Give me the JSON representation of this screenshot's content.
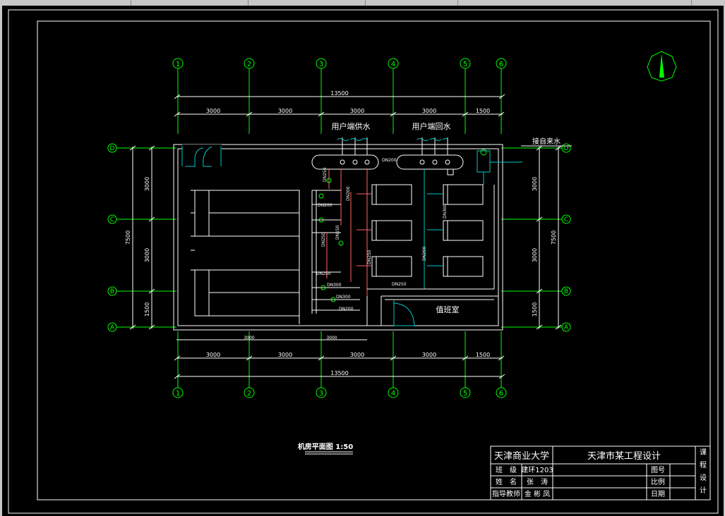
{
  "drawing": {
    "axes_top": [
      "1",
      "2",
      "3",
      "4",
      "5",
      "6"
    ],
    "axes_side": [
      "D",
      "C",
      "B",
      "A"
    ],
    "dims_top": [
      "3000",
      "3000",
      "3000",
      "3000",
      "1500"
    ],
    "dims_bottom": [
      "3000",
      "3000",
      "3000",
      "3000",
      "1500"
    ],
    "total_top": "13500",
    "total_bottom": "13500",
    "dims_lower_sub": [
      "3000",
      "3000"
    ],
    "dims_left": [
      "3000",
      "3000",
      "1500"
    ],
    "dims_right": [
      "3000",
      "3000",
      "1500"
    ],
    "total_left": "7500",
    "total_right": "7500",
    "label_supply": "用户端供水",
    "label_return": "用户端回水",
    "label_city_water": "接自来水",
    "label_room": "值班室",
    "pipe_labels": [
      "DN250",
      "DN200",
      "DN150",
      "DN250",
      "DN200",
      "DN250",
      "DN300",
      "DN300",
      "DN200",
      "DN250",
      "DN200",
      "DN200",
      "DN250",
      "DN300"
    ],
    "caption": "机房平面图 1:50"
  },
  "title_block": {
    "school": "天津商业大学",
    "project": "天津市某工程设计",
    "class_label": "班　级",
    "class_value": "建环1203",
    "name_label": "姓　名",
    "name_value": "张　涛",
    "tutor_label": "指导教师",
    "tutor_value": "金 彬 凤",
    "drawing_no": "图号",
    "scale": "比例",
    "date": "日期",
    "side": [
      "课",
      "程",
      "设",
      "计"
    ]
  },
  "colors": {
    "axis": "#00ff00",
    "line": "#ffffff",
    "pipe": "#ff6464",
    "water": "#00c8c8"
  }
}
